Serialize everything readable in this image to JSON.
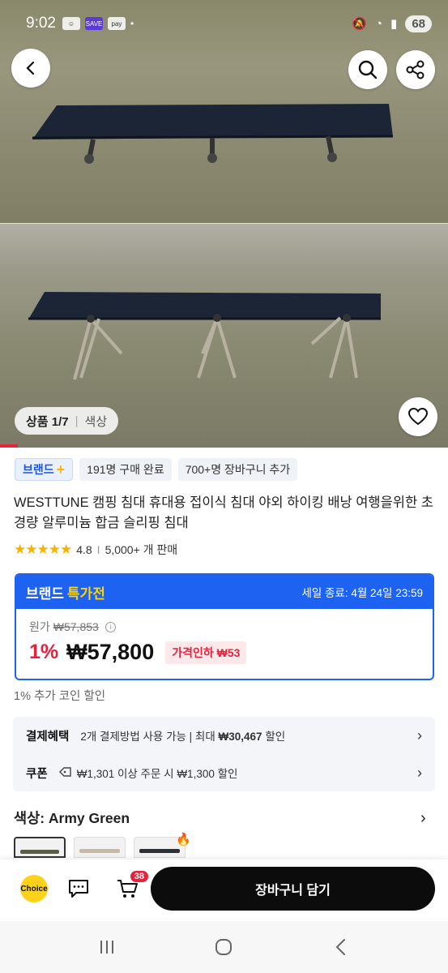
{
  "status": {
    "time": "9:02",
    "battery": "68",
    "mini1": "SAVE",
    "mini2": "pay"
  },
  "gallery": {
    "counter_current": "상품 1/7",
    "counter_tab": "색상"
  },
  "tags": [
    {
      "label": "브랜드",
      "plus": "+"
    },
    {
      "label": "191명 구매 완료"
    },
    {
      "label": "700+명 장바구니 추가"
    }
  ],
  "product": {
    "title": "WESTTUNE 캠핑 침대 휴대용 접이식 침대 야외 하이킹 배낭 여행을위한 초경량 알루미늄 합금 슬리핑 침대",
    "stars": "★★★★★",
    "rating": "4.8",
    "sold": "5,000+ 개 판매",
    "rating_sep": "I"
  },
  "deal": {
    "label": "브랜드",
    "label_highlight": "특가전",
    "end": "세일 종료: 4월 24일 23:59",
    "orig_label": "원가",
    "orig_price": "₩57,853",
    "discount": "1%",
    "price": "₩57,800",
    "drop": "가격인하 ₩53",
    "accent_color": "#1d62f0",
    "sale_color": "#e5233c"
  },
  "coin": "1% 추가 코인 할인",
  "benefits": {
    "payment_label": "결제혜택",
    "payment_text": "2개 결제방법 사용 가능 | 최대 ",
    "payment_bold": "₩30,467",
    "payment_suffix": " 할인",
    "coupon_label": "쿠폰",
    "coupon_text": "₩1,301 이상 주문 시 ₩1,300 할인"
  },
  "color": {
    "label": "색상: Army Green"
  },
  "bottom": {
    "choice": "Choice",
    "cart_count": "38",
    "add_to_cart": "장바구니 담기"
  }
}
